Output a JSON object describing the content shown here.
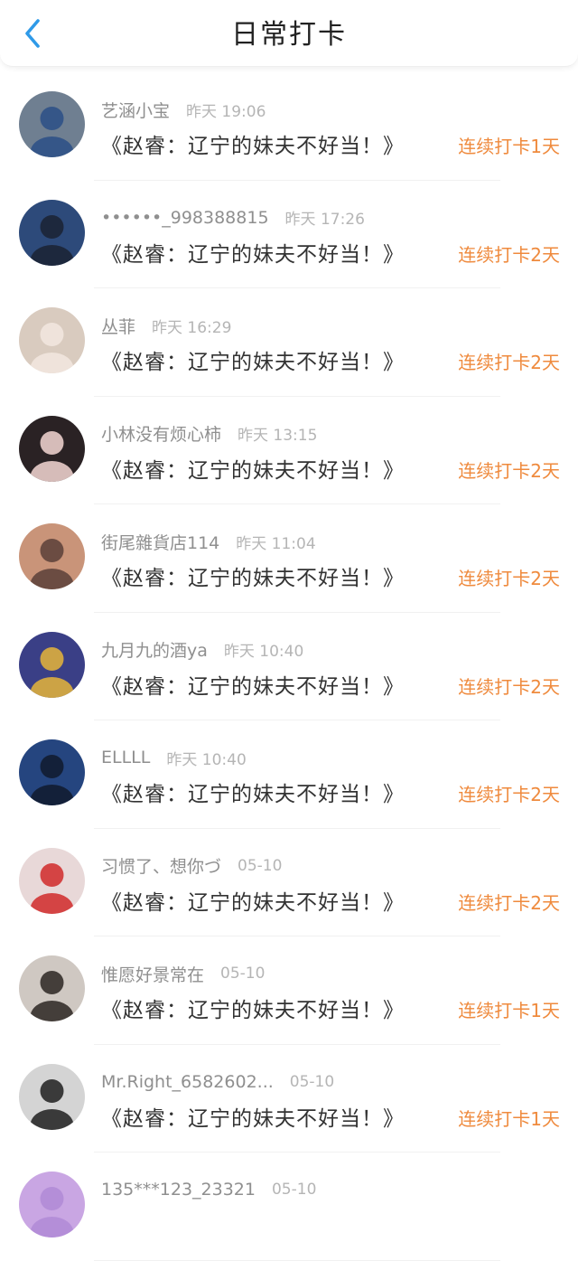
{
  "header": {
    "title": "日常打卡",
    "back_icon": "chevron-left-icon"
  },
  "colors": {
    "accent_blue": "#2f9ae8",
    "streak_orange": "#ef8a3d",
    "name_gray": "#8f8f8f",
    "time_gray": "#b5b5b5"
  },
  "checkins": [
    {
      "name": "艺涵小宝",
      "time": "昨天 19:06",
      "content": "《赵睿：辽宁的妹夫不好当！》",
      "streak": "连续打卡1天",
      "avatar_bg": "#6f7f91",
      "avatar_fg": "#2b4f86"
    },
    {
      "name": "••••••_998388815",
      "time": "昨天 17:26",
      "content": "《赵睿：辽宁的妹夫不好当！》",
      "streak": "连续打卡2天",
      "avatar_bg": "#2d4a7a",
      "avatar_fg": "#1b2233"
    },
    {
      "name": "丛菲",
      "time": "昨天 16:29",
      "content": "《赵睿：辽宁的妹夫不好当！》",
      "streak": "连续打卡2天",
      "avatar_bg": "#d9cbbf",
      "avatar_fg": "#f2e8df"
    },
    {
      "name": "小林没有烦心柿",
      "time": "昨天 13:15",
      "content": "《赵睿：辽宁的妹夫不好当！》",
      "streak": "连续打卡2天",
      "avatar_bg": "#2a2224",
      "avatar_fg": "#f4d7d4"
    },
    {
      "name": "街尾雜貨店114",
      "time": "昨天 11:04",
      "content": "《赵睿：辽宁的妹夫不好当！》",
      "streak": "连续打卡2天",
      "avatar_bg": "#c99479",
      "avatar_fg": "#5a4038"
    },
    {
      "name": "九月九的酒ya",
      "time": "昨天 10:40",
      "content": "《赵睿：辽宁的妹夫不好当！》",
      "streak": "连续打卡2天",
      "avatar_bg": "#3a3f86",
      "avatar_fg": "#e6b53a"
    },
    {
      "name": "ELLLL",
      "time": "昨天 10:40",
      "content": "《赵睿：辽宁的妹夫不好当！》",
      "streak": "连续打卡2天",
      "avatar_bg": "#25457f",
      "avatar_fg": "#111a2d"
    },
    {
      "name": "习惯了、想你づ",
      "time": "05-10",
      "content": "《赵睿：辽宁的妹夫不好当！》",
      "streak": "连续打卡2天",
      "avatar_bg": "#e8d8d8",
      "avatar_fg": "#d02a2a"
    },
    {
      "name": "惟愿好景常在",
      "time": "05-10",
      "content": "《赵睿：辽宁的妹夫不好当！》",
      "streak": "连续打卡1天",
      "avatar_bg": "#cfc8c2",
      "avatar_fg": "#2c2622"
    },
    {
      "name": "Mr.Right_6582602...",
      "time": "05-10",
      "content": "《赵睿：辽宁的妹夫不好当！》",
      "streak": "连续打卡1天",
      "avatar_bg": "#d4d4d4",
      "avatar_fg": "#1f1f1f"
    },
    {
      "name": "135***123_23321",
      "time": "05-10",
      "content": "",
      "streak": "",
      "avatar_bg": "#c9a6e3",
      "avatar_fg": "#b08ad6"
    }
  ]
}
